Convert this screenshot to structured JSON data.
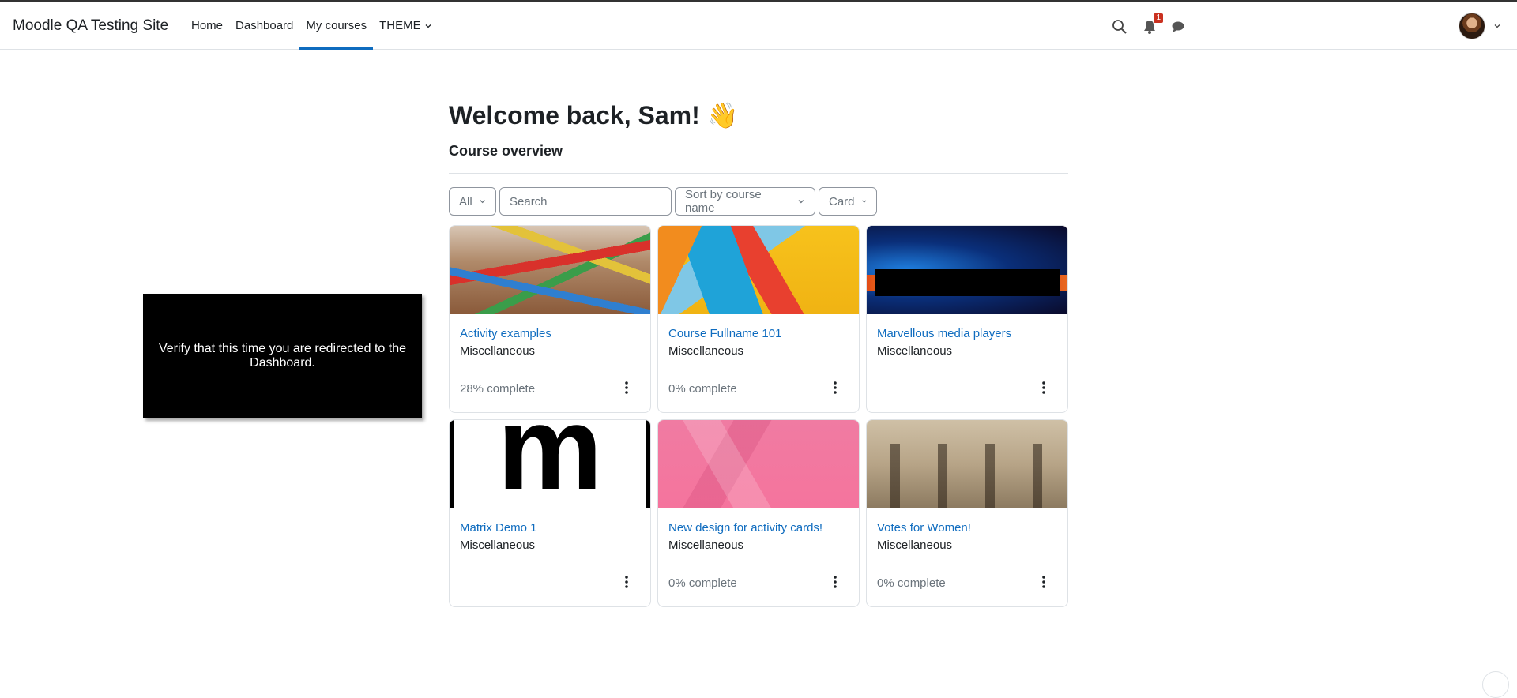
{
  "header": {
    "site_name": "Moodle QA Testing Site",
    "nav": [
      {
        "label": "Home",
        "active": false
      },
      {
        "label": "Dashboard",
        "active": false
      },
      {
        "label": "My courses",
        "active": true
      },
      {
        "label": "THEME",
        "active": false
      }
    ],
    "notification_count": "1",
    "icons": {
      "search": "search-icon",
      "notifications": "bell-icon",
      "messages": "chat-bubble-icon",
      "user_menu": "avatar"
    }
  },
  "main": {
    "welcome": "Welcome back, Sam! 👋",
    "section_title": "Course overview",
    "filters": {
      "grouping": "All",
      "search_placeholder": "Search",
      "sort": "Sort by course name",
      "view": "Card"
    },
    "courses": [
      {
        "title": "Activity examples",
        "category": "Miscellaneous",
        "progress": "28% complete"
      },
      {
        "title": "Course Fullname 101",
        "category": "Miscellaneous",
        "progress": "0% complete"
      },
      {
        "title": "Marvellous media players",
        "category": "Miscellaneous",
        "progress": ""
      },
      {
        "title": "Matrix Demo 1",
        "category": "Miscellaneous",
        "progress": ""
      },
      {
        "title": "New design for activity cards!",
        "category": "Miscellaneous",
        "progress": "0% complete"
      },
      {
        "title": "Votes for Women!",
        "category": "Miscellaneous",
        "progress": "0% complete"
      }
    ],
    "matrix_thumb_letter": "m"
  },
  "overlay": {
    "text": "Verify that this time you are redirected to the Dashboard."
  },
  "colors": {
    "accent": "#0f6cbf",
    "badge": "#ca3120",
    "text": "#1d2125",
    "muted": "#6a737b"
  }
}
